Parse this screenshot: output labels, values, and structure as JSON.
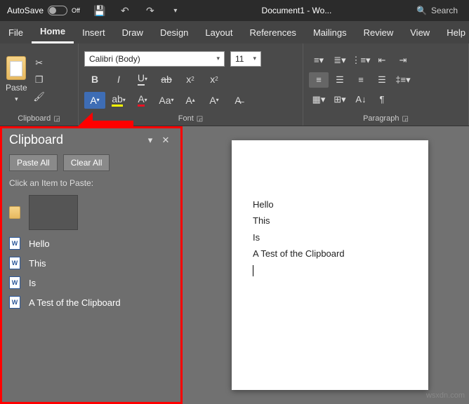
{
  "titlebar": {
    "autosave_label": "AutoSave",
    "autosave_state": "Off",
    "doc_title": "Document1 - Wo...",
    "search_label": "Search"
  },
  "tabs": {
    "file": "File",
    "home": "Home",
    "insert": "Insert",
    "draw": "Draw",
    "design": "Design",
    "layout": "Layout",
    "references": "References",
    "mailings": "Mailings",
    "review": "Review",
    "view": "View",
    "help": "Help"
  },
  "ribbon": {
    "clipboard": {
      "paste": "Paste",
      "label": "Clipboard"
    },
    "font": {
      "name": "Calibri (Body)",
      "size": "11",
      "label": "Font"
    },
    "paragraph": {
      "label": "Paragraph"
    }
  },
  "clipboard_pane": {
    "title": "Clipboard",
    "paste_all": "Paste All",
    "clear_all": "Clear All",
    "hint": "Click an Item to Paste:",
    "items": [
      {
        "type": "image",
        "text": ""
      },
      {
        "type": "text",
        "text": "Hello"
      },
      {
        "type": "text",
        "text": "This"
      },
      {
        "type": "text",
        "text": "Is"
      },
      {
        "type": "text",
        "text": "A Test of the Clipboard"
      }
    ]
  },
  "document": {
    "lines": [
      "Hello",
      "This",
      "Is",
      "A Test of the Clipboard"
    ]
  },
  "watermark": "wsxdn.com"
}
